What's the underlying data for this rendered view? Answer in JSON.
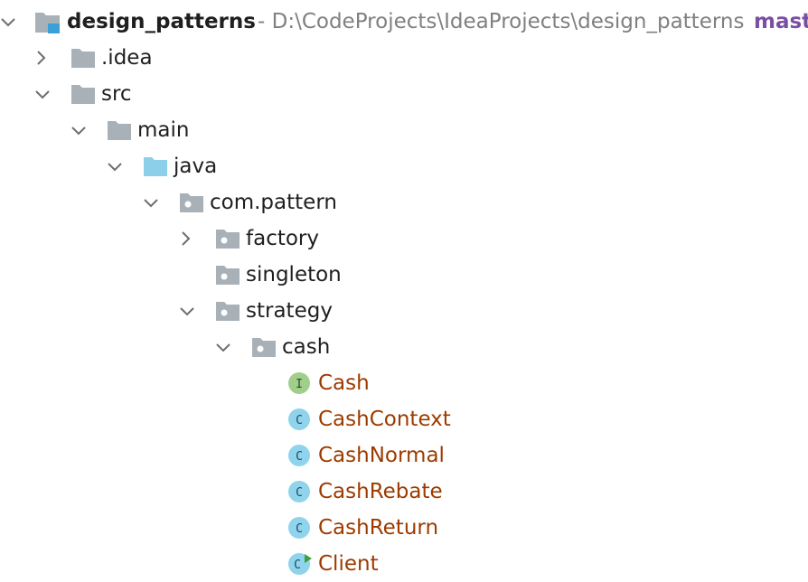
{
  "project": {
    "name": "design_patterns",
    "path": "- D:\\CodeProjects\\IdeaProjects\\design_patterns",
    "branch": "mast"
  },
  "nodes": {
    "idea": ".idea",
    "src": "src",
    "main": "main",
    "java": "java",
    "com_pattern": "com.pattern",
    "factory": "factory",
    "singleton": "singleton",
    "strategy": "strategy",
    "cash": "cash"
  },
  "classes": [
    {
      "name": "Cash",
      "kind": "interface",
      "badge": "I"
    },
    {
      "name": "CashContext",
      "kind": "class",
      "badge": "C"
    },
    {
      "name": "CashNormal",
      "kind": "class",
      "badge": "C"
    },
    {
      "name": "CashRebate",
      "kind": "class",
      "badge": "C"
    },
    {
      "name": "CashReturn",
      "kind": "class",
      "badge": "C"
    },
    {
      "name": "Client",
      "kind": "runnable-class",
      "badge": "C"
    }
  ],
  "colors": {
    "folder": "#a9b1b8",
    "source_folder": "#8ccfe8",
    "class_badge": "#8fd3ec",
    "interface_badge": "#9fcf8a",
    "class_text": "#9c3b00",
    "run_marker": "#3ca03c",
    "path_text": "#808080",
    "branch_text": "#7a4ea3"
  }
}
